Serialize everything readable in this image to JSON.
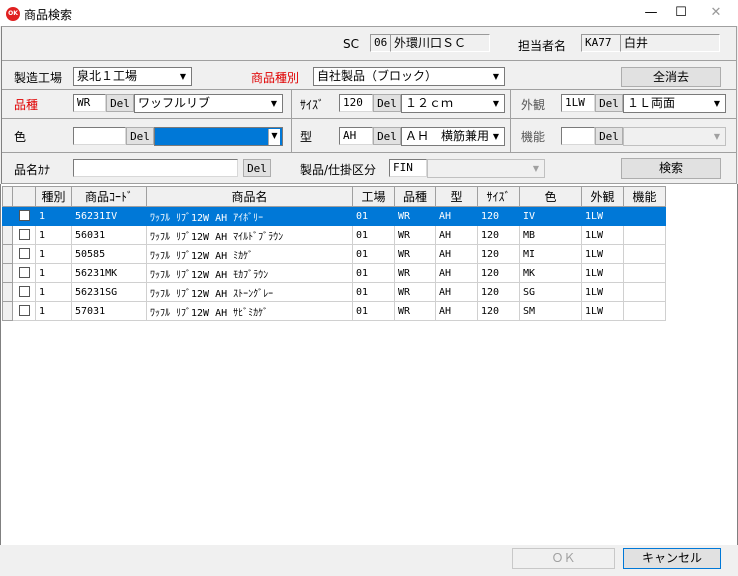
{
  "window": {
    "title": "商品検索",
    "app_icon_text": "OK",
    "minimize": "—",
    "maximize": "☐",
    "close": "✕"
  },
  "header": {
    "sc_label": "SC",
    "sc_code": "06",
    "sc_name": "外環川口ＳＣ",
    "person_label": "担当者名",
    "person_code": "KA77",
    "person_name": "白井"
  },
  "form": {
    "factory_label": "製造工場",
    "factory_value": "泉北１工場",
    "product_type_label": "商品種別",
    "product_type_value": "自社製品（ブロック）",
    "clear_all_label": "全消去",
    "hinshu_label": "品種",
    "hinshu_code": "WR",
    "hinshu_value": "ワッフルリブ",
    "size_label": "ｻｲｽﾞ",
    "size_code": "120",
    "size_value": "１２ｃｍ",
    "gaikan_label": "外観",
    "gaikan_code": "1LW",
    "gaikan_value": "１Ｌ両面",
    "color_label": "色",
    "color_code": "",
    "color_value": "",
    "kata_label": "型",
    "kata_code": "AH",
    "kata_value": "ＡＨ　横筋兼用",
    "kinou_label": "機能",
    "kinou_code": "",
    "kinou_value": "",
    "name_kana_label": "品名ｶﾅ",
    "name_kana_value": "",
    "kubun_label": "製品/仕掛区分",
    "kubun_code": "FIN",
    "kubun_value": "",
    "del_label": "Del",
    "search_label": "検索"
  },
  "table": {
    "columns": [
      "",
      "種別",
      "商品ｺｰﾄﾞ",
      "商品名",
      "工場",
      "品種",
      "型",
      "ｻｲｽﾞ",
      "色",
      "外観",
      "機能"
    ],
    "rows": [
      {
        "shubetsu": "1",
        "code": "56231IV",
        "name": "ﾜｯﾌﾙ ﾘﾌﾞ12W AH ｱｲﾎﾞﾘｰ",
        "factory": "01",
        "hinshu": "WR",
        "kata": "AH",
        "size": "120",
        "color": "IV",
        "gaikan": "1LW",
        "kinou": "",
        "selected": true
      },
      {
        "shubetsu": "1",
        "code": "56031",
        "name": "ﾜｯﾌﾙ ﾘﾌﾞ12W AH ﾏｲﾙﾄﾞﾌﾞﾗｳﾝ",
        "factory": "01",
        "hinshu": "WR",
        "kata": "AH",
        "size": "120",
        "color": "MB",
        "gaikan": "1LW",
        "kinou": "",
        "selected": false
      },
      {
        "shubetsu": "1",
        "code": "50585",
        "name": "ﾜｯﾌﾙ ﾘﾌﾞ12W AH ﾐｶｹﾞ",
        "factory": "01",
        "hinshu": "WR",
        "kata": "AH",
        "size": "120",
        "color": "MI",
        "gaikan": "1LW",
        "kinou": "",
        "selected": false
      },
      {
        "shubetsu": "1",
        "code": "56231MK",
        "name": "ﾜｯﾌﾙ ﾘﾌﾞ12W AH ﾓｶﾌﾞﾗｳﾝ",
        "factory": "01",
        "hinshu": "WR",
        "kata": "AH",
        "size": "120",
        "color": "MK",
        "gaikan": "1LW",
        "kinou": "",
        "selected": false
      },
      {
        "shubetsu": "1",
        "code": "56231SG",
        "name": "ﾜｯﾌﾙ ﾘﾌﾞ12W AH ｽﾄｰﾝｸﾞﾚｰ",
        "factory": "01",
        "hinshu": "WR",
        "kata": "AH",
        "size": "120",
        "color": "SG",
        "gaikan": "1LW",
        "kinou": "",
        "selected": false
      },
      {
        "shubetsu": "1",
        "code": "57031",
        "name": "ﾜｯﾌﾙ ﾘﾌﾞ12W AH ｻﾋﾞﾐｶｹﾞ",
        "factory": "01",
        "hinshu": "WR",
        "kata": "AH",
        "size": "120",
        "color": "SM",
        "gaikan": "1LW",
        "kinou": "",
        "selected": false
      }
    ]
  },
  "footer": {
    "ok_label": "ＯＫ",
    "cancel_label": "キャンセル"
  },
  "colors": {
    "selection": "#0078d7",
    "required_label": "#e00000"
  }
}
